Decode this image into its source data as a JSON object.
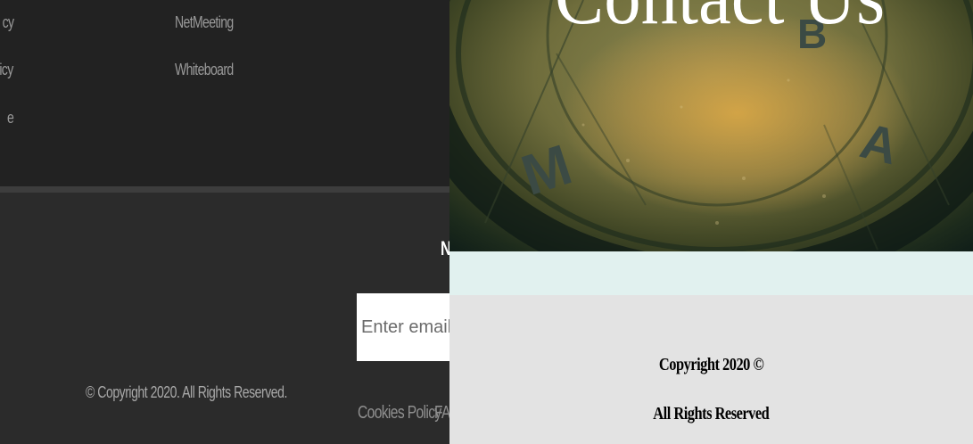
{
  "left_footer": {
    "column_one_fragments": [
      "cy",
      "icy",
      "e"
    ],
    "column_two_links": [
      "NetMeeting",
      "Whiteboard"
    ],
    "column_heading_fragment": "",
    "newsletter_heading_fragment": "N",
    "newsletter_input_placeholder": "Enter email for ne",
    "copyright": "© Copyright 2020. All Rights Reserved.",
    "bottom_links": {
      "cookies": "Cookies Policy",
      "faq_fragment": "FA"
    }
  },
  "contact_page": {
    "hero_title": "Contact Us",
    "hero_letters": [
      "M",
      "A",
      "B"
    ],
    "copyright_line_1": "Copyright 2020 ©",
    "copyright_line_2": "All Rights Reserved"
  },
  "colors": {
    "left_dark": "#222222",
    "left_lower": "#2b2b2b",
    "mint_band": "#e1f1ef",
    "right_footer": "#e3e3e3"
  }
}
